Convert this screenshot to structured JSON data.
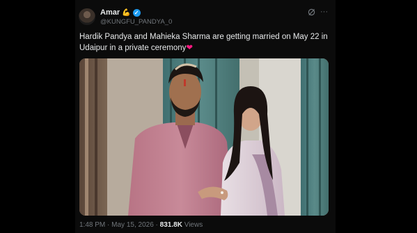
{
  "post": {
    "author_name": "Amar",
    "author_emoji": "💪",
    "verified_mark": "✓",
    "handle": "@KUNGFU_PANDYA_0",
    "text": "Hardik Pandya and Mahieka Sharma are getting married on May 22 in Udaipur in a private ceremony",
    "text_emoji": "❤",
    "photo_icon": "wedding-couple-photo",
    "more_glyph": "···",
    "time": "1:48 PM",
    "separator": "·",
    "date": "May 15, 2026",
    "views_count": "831.8K",
    "views_label": "Views"
  },
  "colors": {
    "background": "#000000",
    "text": "#e7e9ea",
    "muted": "#71767b",
    "verified": "#1d9bf0",
    "heart": "#f91880"
  }
}
